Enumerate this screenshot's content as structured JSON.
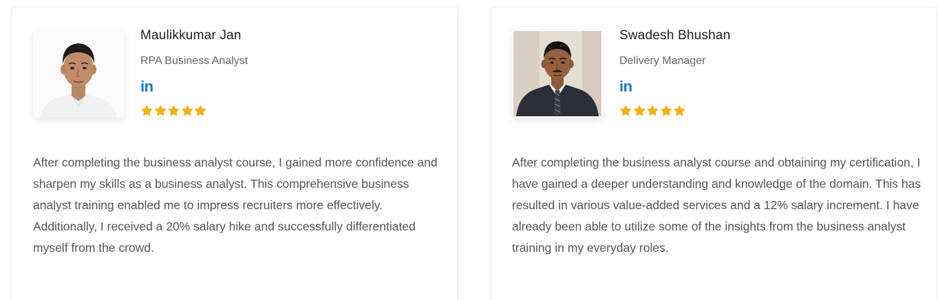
{
  "testimonials": [
    {
      "name": "Maulikkumar Jan",
      "role": "RPA Business Analyst",
      "social": "in",
      "rating": 5,
      "quote": "After completing the business analyst course, I gained more confidence and sharpen my skills as a business analyst. This comprehensive business analyst training enabled me to impress recruiters more effectively. Additionally, I received a 20% salary hike and successfully differentiated myself from the crowd."
    },
    {
      "name": "Swadesh Bhushan",
      "role": "Delivery Manager",
      "social": "in",
      "rating": 5,
      "quote": "After completing the business analyst course and obtaining my certification, I have gained a deeper understanding and knowledge of the domain. This has resulted in various value-added services and a 12% salary increment. I have already been able to utilize some of the insights from the business analyst training in my everyday roles."
    }
  ],
  "colors": {
    "linkedin": "#1d76c2",
    "star": "#f5b301",
    "name": "#222222",
    "body_text": "#555555"
  },
  "icons": {
    "social": "linkedin-icon",
    "rating": "star-icon"
  }
}
